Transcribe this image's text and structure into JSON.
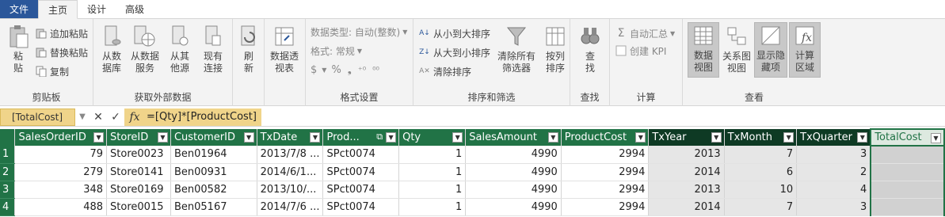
{
  "tabs": [
    "文件",
    "主页",
    "设计",
    "高级"
  ],
  "ribbon": {
    "clipboard": {
      "label": "剪贴板",
      "paste": "粘\n贴",
      "append_paste": "追加粘贴",
      "replace_paste": "替换粘贴",
      "copy": "复制"
    },
    "external": {
      "label": "获取外部数据",
      "from_db": "从数\n据库",
      "from_service": "从数据\n服务",
      "from_other": "从其\n他源",
      "existing": "现有\n连接"
    },
    "refresh": {
      "label": "刷\n新"
    },
    "pivot": {
      "label": "数据透\n视表"
    },
    "format": {
      "label": "格式设置",
      "data_type": "数据类型: 自动(整数)",
      "format": "格式: 常规",
      "symbols": [
        "$",
        "%",
        "❟",
        "⁺⁰",
        "⁰⁰"
      ]
    },
    "sort": {
      "label": "排序和筛选",
      "asc": "从小到大排序",
      "desc": "从大到小排序",
      "clear_sort": "清除排序",
      "clear_filters": "清除所有\n筛选器",
      "by_column": "按列\n排序"
    },
    "find": {
      "group_label": "查找",
      "label": "查\n找"
    },
    "calc": {
      "label": "计算",
      "autosum": "自动汇总",
      "kpi": "创建 KPI"
    },
    "view": {
      "label": "查看",
      "data_view": "数据\n视图",
      "diagram_view": "关系图\n视图",
      "show_hidden": "显示隐\n藏项",
      "calc_area": "计算\n区域"
    }
  },
  "formula_bar": {
    "name_box": "[TotalCost]",
    "cancel": "✕",
    "confirm": "✓",
    "fx": "fx",
    "formula": "=[Qty]*[ProductCost]"
  },
  "grid": {
    "columns": [
      "SalesOrderID",
      "StoreID",
      "CustomerID",
      "TxDate",
      "Prod...",
      "Qty",
      "SalesAmount",
      "ProductCost",
      "TxYear",
      "TxMonth",
      "TxQuarter",
      "TotalCost"
    ],
    "rows": [
      {
        "n": "1",
        "cells": [
          "79",
          "Store0023",
          "Ben01964",
          "2013/7/8 ...",
          "SPct0074",
          "1",
          "4990",
          "2994",
          "2013",
          "7",
          "3",
          ""
        ]
      },
      {
        "n": "2",
        "cells": [
          "279",
          "Store0141",
          "Ben00931",
          "2014/6/1...",
          "SPct0074",
          "1",
          "4990",
          "2994",
          "2014",
          "6",
          "2",
          ""
        ]
      },
      {
        "n": "3",
        "cells": [
          "348",
          "Store0169",
          "Ben00582",
          "2013/10/...",
          "SPct0074",
          "1",
          "4990",
          "2994",
          "2013",
          "10",
          "4",
          ""
        ]
      },
      {
        "n": "4",
        "cells": [
          "488",
          "Store0015",
          "Ben05167",
          "2014/7/6 ...",
          "SPct0074",
          "1",
          "4990",
          "2994",
          "2014",
          "7",
          "3",
          ""
        ]
      }
    ]
  },
  "colors": {
    "accent": "#217346",
    "file_tab": "#2b579a",
    "highlight": "#f0d48a"
  }
}
